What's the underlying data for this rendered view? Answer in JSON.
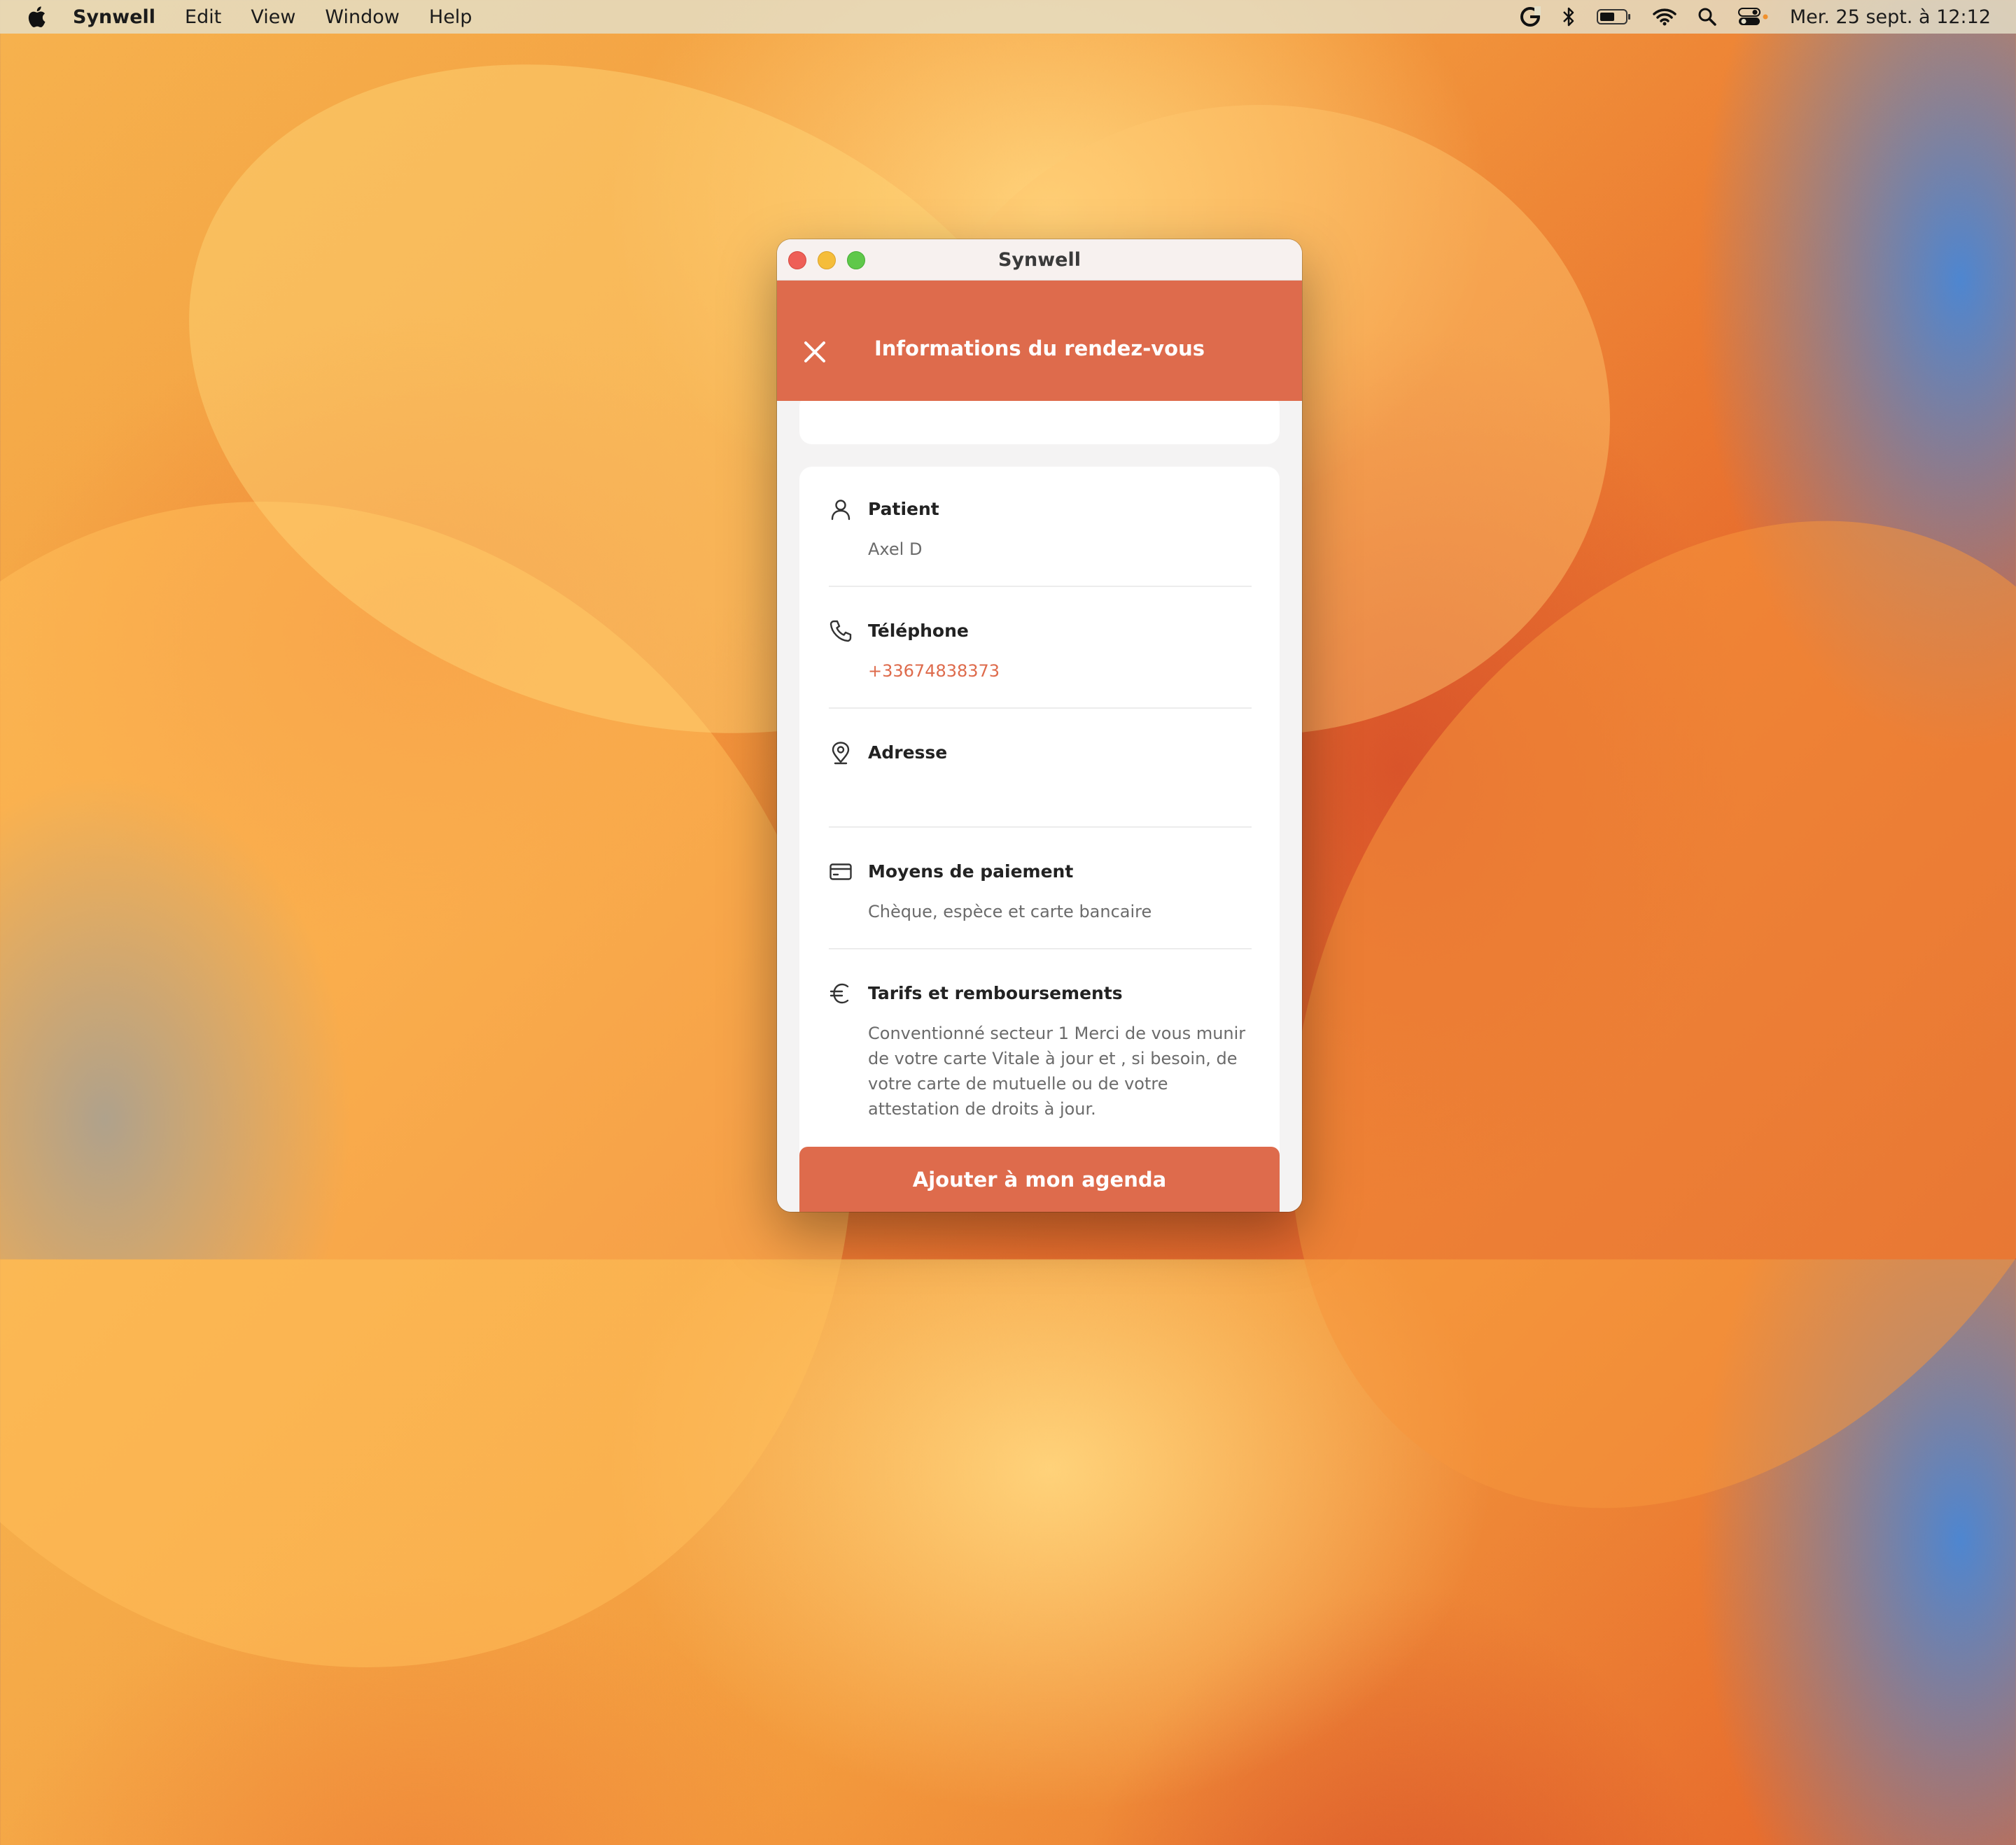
{
  "menubar": {
    "app_name": "Synwell",
    "items": [
      "Edit",
      "View",
      "Window",
      "Help"
    ],
    "clock": "Mer. 25 sept. à 12:12"
  },
  "window": {
    "title": "Synwell",
    "header_title": "Informations du rendez-vous"
  },
  "details": {
    "patient": {
      "label": "Patient",
      "value": "Axel D"
    },
    "phone": {
      "label": "Téléphone",
      "value": "+33674838373"
    },
    "address": {
      "label": "Adresse",
      "value": ""
    },
    "payment": {
      "label": "Moyens de paiement",
      "value": "Chèque, espèce et carte bancaire"
    },
    "fees": {
      "label": "Tarifs et remboursements",
      "value": "Conventionné secteur 1 Merci de vous munir de votre carte Vitale à jour et , si besoin, de votre carte de mutuelle ou de votre attestation de droits à jour."
    }
  },
  "cta_label": "Ajouter à mon agenda",
  "colors": {
    "accent": "#de6b4c",
    "text": "#222222",
    "muted": "#6b6b6b"
  }
}
